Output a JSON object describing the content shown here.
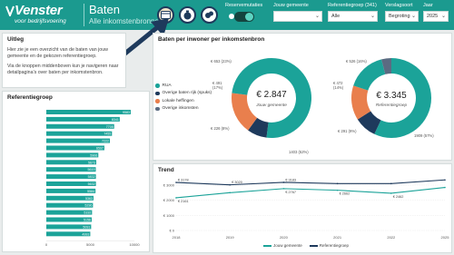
{
  "header": {
    "logo_main": "Venster",
    "logo_sub": "voor bedrijfsvoering",
    "title": "Baten",
    "subtitle": "Alle inkomstenbronnen",
    "controls": {
      "reservemutaties_label": "Reservemutaties",
      "jouw_gemeente_label": "Jouw gemeente",
      "referentiegroep_label": "Referentiegroep (341)",
      "referentiegroep_value": "Alle",
      "verslagsoort_label": "Verslagsoort",
      "verslagsoort_value": "Begroting",
      "jaar_label": "Jaar",
      "jaar_value": "2025"
    }
  },
  "uitleg": {
    "title": "Uitleg",
    "para1": "Hier zie je een overzicht van de baten van jouw gemeente en de gekozen referentiegroep.",
    "para2": "Via de knoppen middenboven kun je navigeren naar detailpagina's over baten per inkomstenbron."
  },
  "referentiegroep": {
    "title": "Referentiegroep",
    "bars": [
      {
        "value": 9583,
        "label": "9583"
      },
      {
        "value": 8341,
        "label": "8341"
      },
      {
        "value": 7705,
        "label": "7705"
      },
      {
        "value": 7455,
        "label": "7455"
      },
      {
        "value": 7222,
        "label": "7222"
      },
      {
        "value": 6597,
        "label": "6597"
      },
      {
        "value": 5906,
        "label": "5906"
      },
      {
        "value": 5673,
        "label": "5673"
      },
      {
        "value": 5619,
        "label": "5619"
      },
      {
        "value": 5632,
        "label": "5832"
      },
      {
        "value": 5632,
        "label": "5632"
      },
      {
        "value": 5584,
        "label": "5584"
      },
      {
        "value": 5363,
        "label": "5363"
      },
      {
        "value": 5296,
        "label": "5296"
      },
      {
        "value": 5192,
        "label": "5192"
      },
      {
        "value": 5156,
        "label": "5156"
      },
      {
        "value": 5091,
        "label": "5091"
      },
      {
        "value": 4993,
        "label": "4993"
      }
    ],
    "axis_ticks": [
      "0",
      "5000",
      "10000"
    ]
  },
  "per_inwoner": {
    "title": "Baten per inwoner per inkomstenbron",
    "legend": [
      {
        "label": "RUA",
        "color": "#1ba399"
      },
      {
        "label": "Overige baten rijk (spuks)",
        "color": "#1e3a5c"
      },
      {
        "label": "Lokale heffingen",
        "color": "#e97f4d"
      },
      {
        "label": "Overige inkomsten",
        "color": "#5b6b82"
      }
    ],
    "left_donut": {
      "center_value": "€ 2.847",
      "center_label": "Jouw gemeente",
      "label_top": "€ 653 (23%)",
      "label_left1": "€ 491",
      "label_left2": "(17%)",
      "label_bottom_left": "€ 226 (8%)",
      "label_bottom_right": "1403 (52%)"
    },
    "right_donut": {
      "center_value": "€ 3.345",
      "center_label": "Referentiegroep",
      "label_top": "€ 526 (16%)",
      "label_left1": "€ 472",
      "label_left2": "(14%)",
      "label_bottom_left": "€ 291 (9%)",
      "label_bottom_right": "1909 (57%)"
    }
  },
  "trend": {
    "title": "Trend",
    "legend_a": "Jouw gemeente",
    "legend_b": "Referentiegroep"
  },
  "chart_data": {
    "type": "line",
    "title": "Trend",
    "x": [
      2018,
      2019,
      2020,
      2021,
      2022,
      2025
    ],
    "x_ticks": [
      "2018",
      "2019",
      "2020",
      "2021",
      "2022",
      "2025"
    ],
    "y_ticks": [
      "€ 0",
      "€ 1000",
      "€ 2000",
      "€ 3000"
    ],
    "ylim": [
      0,
      3600
    ],
    "series": [
      {
        "name": "Jouw gemeente",
        "color": "#1ba399",
        "values": [
          2161,
          2500,
          2767,
          2662,
          2462,
          2847
        ],
        "labels": [
          "€ 2161",
          "",
          "€ 2767",
          "€ 2662",
          "€ 2462",
          ""
        ]
      },
      {
        "name": "Referentiegroep",
        "color": "#1e3a5c",
        "values": [
          3178,
          3020,
          3183,
          3100,
          3100,
          3345
        ],
        "labels": [
          "€ 3178",
          "€ 3020",
          "€ 3183",
          "",
          "",
          ""
        ]
      }
    ]
  }
}
